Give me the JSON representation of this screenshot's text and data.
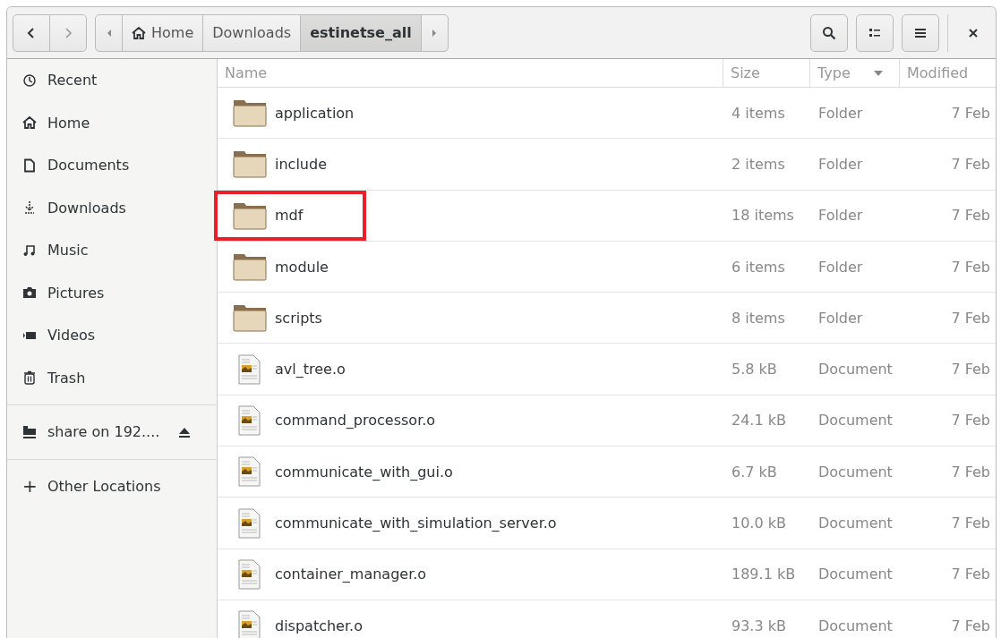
{
  "breadcrumb": [
    {
      "label": "Home",
      "kind": "home",
      "selected": false
    },
    {
      "label": "Downloads",
      "kind": "folder",
      "selected": false
    },
    {
      "label": "estinetse_all",
      "kind": "folder",
      "selected": true
    }
  ],
  "sidebar": {
    "items": [
      {
        "label": "Recent",
        "kind": "recent"
      },
      {
        "label": "Home",
        "kind": "home"
      },
      {
        "label": "Documents",
        "kind": "document"
      },
      {
        "label": "Downloads",
        "kind": "download"
      },
      {
        "label": "Music",
        "kind": "music"
      },
      {
        "label": "Pictures",
        "kind": "camera"
      },
      {
        "label": "Videos",
        "kind": "video"
      },
      {
        "label": "Trash",
        "kind": "trash"
      }
    ],
    "network": {
      "label": "share on 192....",
      "kind": "network"
    },
    "other": {
      "label": "Other Locations",
      "symbol": "+"
    }
  },
  "table": {
    "columns": [
      {
        "label": "Name"
      },
      {
        "label": "Size"
      },
      {
        "label": "Type",
        "sorted": true
      },
      {
        "label": "Modified"
      }
    ],
    "rows": [
      {
        "kind": "folder",
        "name": "application",
        "size": "4 items",
        "type": "Folder",
        "modified": "7 Feb",
        "highlighted": false
      },
      {
        "kind": "folder",
        "name": "include",
        "size": "2 items",
        "type": "Folder",
        "modified": "7 Feb",
        "highlighted": false
      },
      {
        "kind": "folder",
        "name": "mdf",
        "size": "18 items",
        "type": "Folder",
        "modified": "7 Feb",
        "highlighted": true
      },
      {
        "kind": "folder",
        "name": "module",
        "size": "6 items",
        "type": "Folder",
        "modified": "7 Feb",
        "highlighted": false
      },
      {
        "kind": "folder",
        "name": "scripts",
        "size": "8 items",
        "type": "Folder",
        "modified": "7 Feb",
        "highlighted": false
      },
      {
        "kind": "document",
        "name": "avl_tree.o",
        "size": "5.8 kB",
        "type": "Document",
        "modified": "7 Feb",
        "highlighted": false
      },
      {
        "kind": "document",
        "name": "command_processor.o",
        "size": "24.1 kB",
        "type": "Document",
        "modified": "7 Feb",
        "highlighted": false
      },
      {
        "kind": "document",
        "name": "communicate_with_gui.o",
        "size": "6.7 kB",
        "type": "Document",
        "modified": "7 Feb",
        "highlighted": false
      },
      {
        "kind": "document",
        "name": "communicate_with_simulation_server.o",
        "size": "10.0 kB",
        "type": "Document",
        "modified": "7 Feb",
        "highlighted": false
      },
      {
        "kind": "document",
        "name": "container_manager.o",
        "size": "189.1 kB",
        "type": "Document",
        "modified": "7 Feb",
        "highlighted": false
      },
      {
        "kind": "document",
        "name": "dispatcher.o",
        "size": "93.3 kB",
        "type": "Document",
        "modified": "7 Feb",
        "highlighted": false
      }
    ]
  }
}
